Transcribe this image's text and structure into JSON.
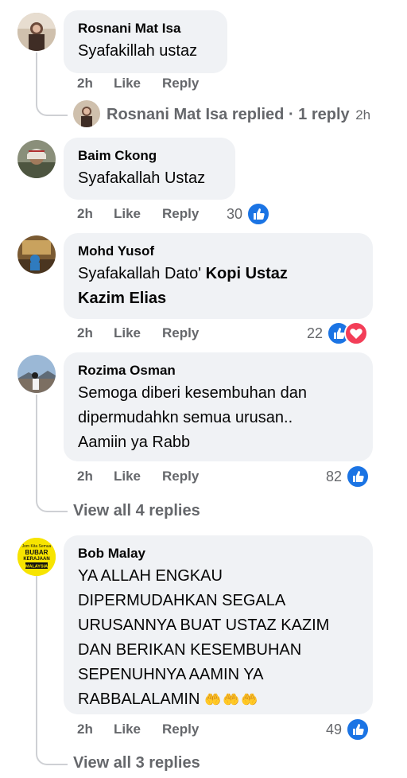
{
  "comments": [
    {
      "author": "Rosnani Mat Isa",
      "text": "Syafakillah ustaz",
      "time": "2h",
      "like": "Like",
      "reply": "Reply"
    },
    {
      "author": "Baim Ckong",
      "text": "Syafakallah Ustaz",
      "time": "2h",
      "like": "Like",
      "reply": "Reply",
      "reactions": "30"
    },
    {
      "author": "Mohd Yusof",
      "text_plain": "Syafakallah Dato'",
      "text_bold_1": "Kopi Ustaz",
      "text_bold_2": "Kazim Elias",
      "time": "2h",
      "like": "Like",
      "reply": "Reply",
      "reactions": "22"
    },
    {
      "author": "Rozima Osman",
      "lines": [
        "Semoga diberi kesembuhan dan",
        "dipermudahkn semua urusan..",
        "Aamiin ya Rabb"
      ],
      "time": "2h",
      "like": "Like",
      "reply": "Reply",
      "reactions": "82"
    },
    {
      "author": "Bob Malay",
      "lines": [
        "YA ALLAH ENGKAU",
        "DIPERMUDAHKAN SEGALA",
        "URUSANNYA BUAT USTAZ KAZIM",
        "DAN BERIKAN KESEMBUHAN",
        "SEPENUHNYA AAMIN YA",
        "RABBALALAMIN"
      ],
      "emoji": "🤲🤲🤲",
      "time": "2h",
      "like": "Like",
      "reply": "Reply",
      "reactions": "49"
    }
  ],
  "reply_summary_1": {
    "text": "Rosnani Mat Isa replied",
    "sep": " · ",
    "count": "1 reply",
    "time": "2h"
  },
  "view_replies_4": "View all 4 replies",
  "view_replies_3": "View all 3 replies",
  "colors": {
    "bubble": "#f0f2f5",
    "meta": "#65676b",
    "like_blue": "#1b74e4",
    "love_red": "#f33e58",
    "thread_line": "#ced0d4"
  },
  "avatar_bubar_text": {
    "l1": "Jom Kita Semua",
    "l2": "BUBAR",
    "l3": "KERAJAAN",
    "l4": "MALAYSIA"
  }
}
